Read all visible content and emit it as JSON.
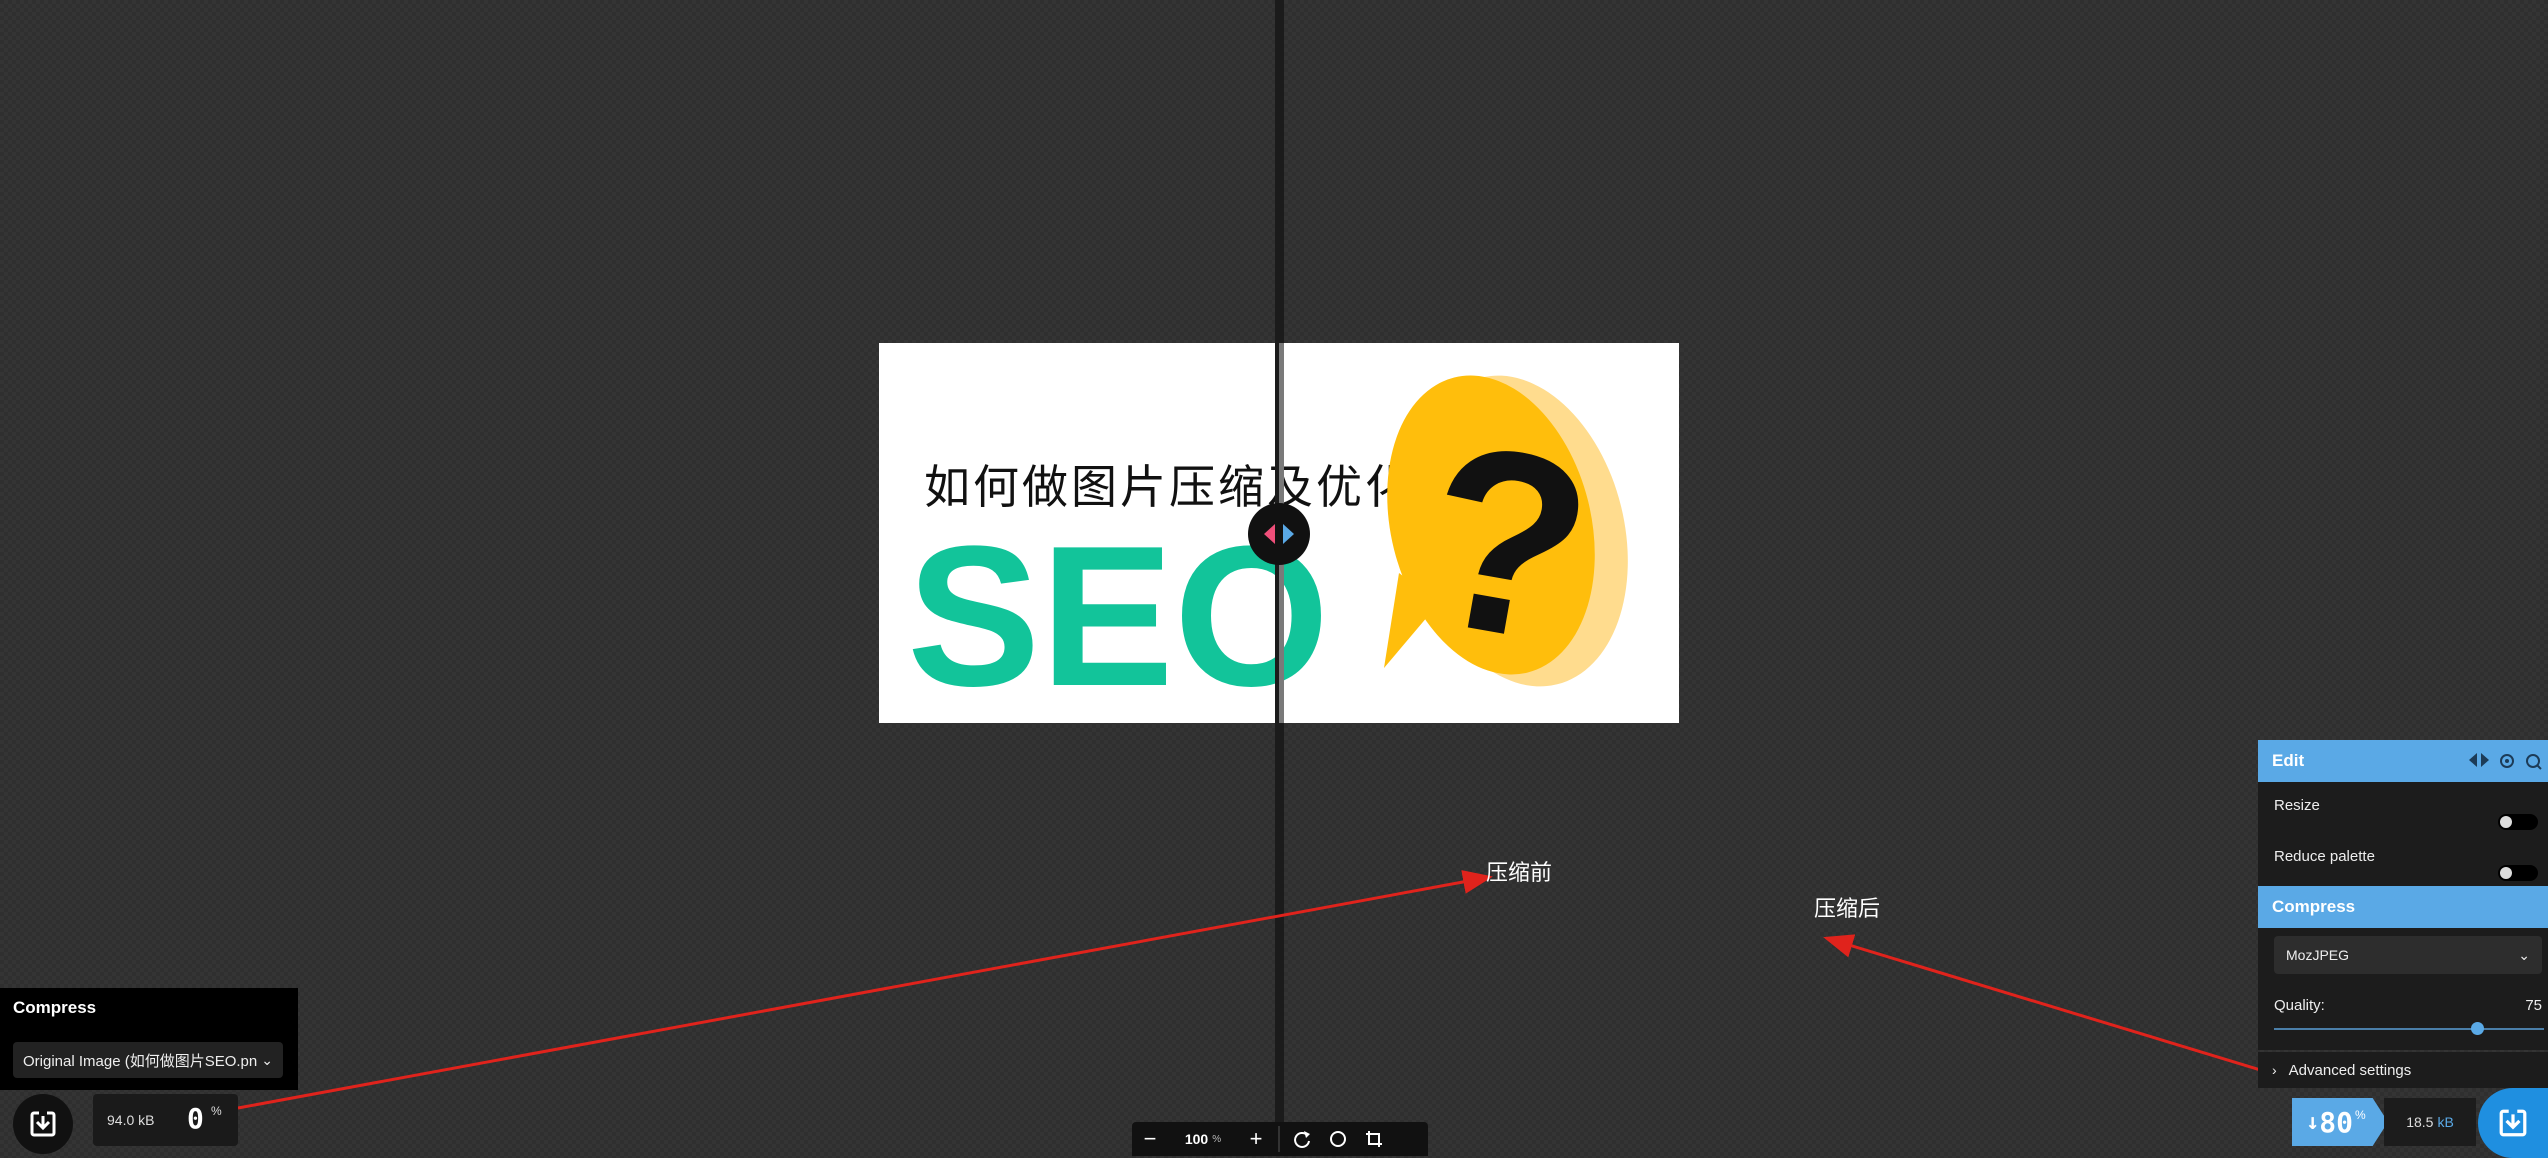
{
  "image": {
    "title_text": "如何做图片压缩及优化",
    "seo_text": "SEO",
    "question_mark": "?"
  },
  "annotations": {
    "before_label": "压缩前",
    "after_label": "压缩后",
    "arrow_color": "#e0231c"
  },
  "left_panel": {
    "title": "Compress",
    "select_value": "Original Image (如何做图片SEO.pn",
    "size_value": "94.0",
    "size_unit": "kB",
    "percent_value": "0",
    "percent_sign": "%"
  },
  "toolbar": {
    "zoom_value": "100",
    "zoom_unit": "%",
    "zoom_out_icon": "minus-icon",
    "zoom_in_icon": "plus-icon",
    "rotate_icon": "rotate-icon",
    "background_icon": "circle-icon",
    "crop_icon": "crop-icon"
  },
  "right_panel": {
    "edit_title": "Edit",
    "resize_label": "Resize",
    "reduce_palette_label": "Reduce palette",
    "compress_title": "Compress",
    "codec_value": "MozJPEG",
    "quality_label": "Quality:",
    "quality_value": "75",
    "quality_level": 0.75,
    "advanced_label": "Advanced settings",
    "savings_arrow": "↓",
    "savings_value": "80",
    "savings_sign": "%",
    "size_value": "18.5",
    "size_unit": "kB",
    "accent_color": "#5aa9e6"
  }
}
